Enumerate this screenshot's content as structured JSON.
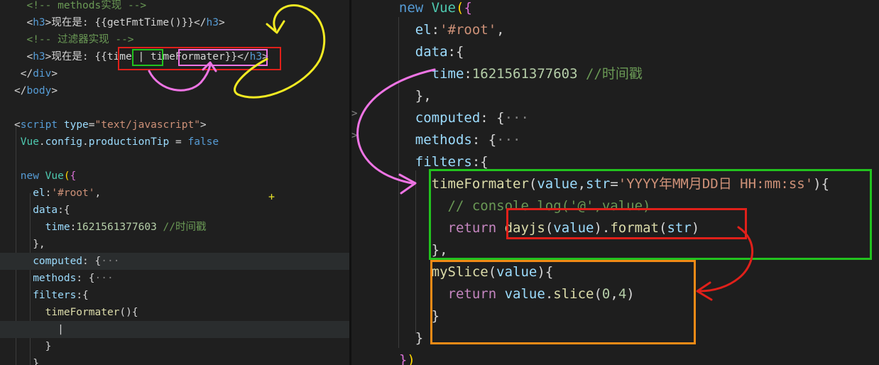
{
  "left_editor": {
    "lines": [
      [
        {
          "c": "t-cm",
          "t": "  <!-- methods实现 -->"
        }
      ],
      [
        {
          "c": "t-tx",
          "t": "  <"
        },
        {
          "c": "t-tag",
          "t": "h3"
        },
        {
          "c": "t-tx",
          "t": ">现在是: {{getFmtTime()}}</"
        },
        {
          "c": "t-tag",
          "t": "h3"
        },
        {
          "c": "t-tx",
          "t": ">"
        }
      ],
      [
        {
          "c": "t-cm",
          "t": "  <!-- 过滤器实现 -->"
        }
      ],
      [
        {
          "c": "t-tx",
          "t": "  <"
        },
        {
          "c": "t-tag",
          "t": "h3"
        },
        {
          "c": "t-tx",
          "t": ">现在是: {{time | timeFormater}}</"
        },
        {
          "c": "t-tag",
          "t": "h3"
        },
        {
          "c": "t-tx",
          "t": ">"
        }
      ],
      [
        {
          "c": "t-tx",
          "t": " </"
        },
        {
          "c": "t-tag",
          "t": "div"
        },
        {
          "c": "t-tx",
          "t": ">"
        }
      ],
      [
        {
          "c": "t-tx",
          "t": "</"
        },
        {
          "c": "t-tag",
          "t": "body"
        },
        {
          "c": "t-tx",
          "t": ">"
        }
      ],
      [],
      [
        {
          "c": "t-tx",
          "t": "<"
        },
        {
          "c": "t-tag",
          "t": "script"
        },
        {
          "c": "t-tx",
          "t": " "
        },
        {
          "c": "t-key",
          "t": "type"
        },
        {
          "c": "t-tx",
          "t": "="
        },
        {
          "c": "t-str",
          "t": "\"text/javascript\""
        },
        {
          "c": "t-tx",
          "t": ">"
        }
      ],
      [
        {
          "c": "t-ty",
          "t": " Vue"
        },
        {
          "c": "t-tx",
          "t": "."
        },
        {
          "c": "t-key",
          "t": "config"
        },
        {
          "c": "t-tx",
          "t": "."
        },
        {
          "c": "t-key",
          "t": "productionTip"
        },
        {
          "c": "t-tx",
          "t": " = "
        },
        {
          "c": "t-bool",
          "t": "false"
        }
      ],
      [],
      [
        {
          "c": "t-bool",
          "t": " new"
        },
        {
          "c": "t-tx",
          "t": " "
        },
        {
          "c": "t-ty",
          "t": "Vue"
        },
        {
          "c": "t-br",
          "t": "("
        },
        {
          "c": "t-pu",
          "t": "{"
        }
      ],
      [
        {
          "c": "t-key",
          "t": "   el"
        },
        {
          "c": "t-tx",
          "t": ":"
        },
        {
          "c": "t-str",
          "t": "'#root'"
        },
        {
          "c": "t-tx",
          "t": ","
        }
      ],
      [
        {
          "c": "t-key",
          "t": "   data"
        },
        {
          "c": "t-tx",
          "t": ":{"
        }
      ],
      [
        {
          "c": "t-key",
          "t": "     time"
        },
        {
          "c": "t-tx",
          "t": ":"
        },
        {
          "c": "t-num",
          "t": "1621561377603"
        },
        {
          "c": "t-tx",
          "t": " "
        },
        {
          "c": "t-cm",
          "t": "//时间戳"
        }
      ],
      [
        {
          "c": "t-tx",
          "t": "   },"
        }
      ],
      [
        {
          "c": "t-key",
          "t": "   computed"
        },
        {
          "c": "t-tx",
          "t": ": {"
        },
        {
          "c": "t-dim",
          "t": "···"
        }
      ],
      [
        {
          "c": "t-key",
          "t": "   methods"
        },
        {
          "c": "t-tx",
          "t": ": {"
        },
        {
          "c": "t-dim",
          "t": "···"
        }
      ],
      [
        {
          "c": "t-key",
          "t": "   filters"
        },
        {
          "c": "t-tx",
          "t": ":{"
        }
      ],
      [
        {
          "c": "t-fn",
          "t": "     timeFormater"
        },
        {
          "c": "t-tx",
          "t": "(){"
        }
      ],
      [
        {
          "c": "t-tx",
          "t": "       |"
        }
      ],
      [
        {
          "c": "t-tx",
          "t": "     }"
        }
      ],
      [
        {
          "c": "t-tx",
          "t": "   }"
        }
      ]
    ]
  },
  "right_editor": {
    "lines": [
      [
        {
          "c": "t-bool",
          "t": "  new"
        },
        {
          "c": "t-tx",
          "t": " "
        },
        {
          "c": "t-ty",
          "t": "Vue"
        },
        {
          "c": "t-br",
          "t": "("
        },
        {
          "c": "t-pu",
          "t": "{"
        }
      ],
      [
        {
          "c": "t-key",
          "t": "    el"
        },
        {
          "c": "t-tx",
          "t": ":"
        },
        {
          "c": "t-str",
          "t": "'#root'"
        },
        {
          "c": "t-tx",
          "t": ","
        }
      ],
      [
        {
          "c": "t-key",
          "t": "    data"
        },
        {
          "c": "t-tx",
          "t": ":{"
        }
      ],
      [
        {
          "c": "t-key",
          "t": "      time"
        },
        {
          "c": "t-tx",
          "t": ":"
        },
        {
          "c": "t-num",
          "t": "1621561377603"
        },
        {
          "c": "t-tx",
          "t": " "
        },
        {
          "c": "t-cm",
          "t": "//时间戳"
        }
      ],
      [
        {
          "c": "t-tx",
          "t": "    },"
        }
      ],
      [
        {
          "c": "t-key",
          "t": "    computed"
        },
        {
          "c": "t-tx",
          "t": ": {"
        },
        {
          "c": "t-dim",
          "t": "···"
        }
      ],
      [
        {
          "c": "t-key",
          "t": "    methods"
        },
        {
          "c": "t-tx",
          "t": ": {"
        },
        {
          "c": "t-dim",
          "t": "···"
        }
      ],
      [
        {
          "c": "t-key",
          "t": "    filters"
        },
        {
          "c": "t-tx",
          "t": ":{"
        }
      ],
      [
        {
          "c": "t-fn",
          "t": "      timeFormater"
        },
        {
          "c": "t-tx",
          "t": "("
        },
        {
          "c": "t-key",
          "t": "value"
        },
        {
          "c": "t-tx",
          "t": ","
        },
        {
          "c": "t-key",
          "t": "str"
        },
        {
          "c": "t-tx",
          "t": "="
        },
        {
          "c": "t-str",
          "t": "'YYYY年MM月DD日 HH:mm:ss'"
        },
        {
          "c": "t-tx",
          "t": "){"
        }
      ],
      [
        {
          "c": "t-cm",
          "t": "        // console.log('@',value)"
        }
      ],
      [
        {
          "c": "t-kw",
          "t": "        return"
        },
        {
          "c": "t-tx",
          "t": " "
        },
        {
          "c": "t-fn",
          "t": "dayjs"
        },
        {
          "c": "t-tx",
          "t": "("
        },
        {
          "c": "t-key",
          "t": "value"
        },
        {
          "c": "t-tx",
          "t": ")."
        },
        {
          "c": "t-fn",
          "t": "format"
        },
        {
          "c": "t-tx",
          "t": "("
        },
        {
          "c": "t-key",
          "t": "str"
        },
        {
          "c": "t-tx",
          "t": ")"
        }
      ],
      [
        {
          "c": "t-tx",
          "t": "      },"
        }
      ],
      [
        {
          "c": "t-fn",
          "t": "      mySlice"
        },
        {
          "c": "t-tx",
          "t": "("
        },
        {
          "c": "t-key",
          "t": "value"
        },
        {
          "c": "t-tx",
          "t": "){"
        }
      ],
      [
        {
          "c": "t-kw",
          "t": "        return"
        },
        {
          "c": "t-tx",
          "t": " "
        },
        {
          "c": "t-key",
          "t": "value"
        },
        {
          "c": "t-tx",
          "t": "."
        },
        {
          "c": "t-fn",
          "t": "slice"
        },
        {
          "c": "t-tx",
          "t": "("
        },
        {
          "c": "t-num",
          "t": "0"
        },
        {
          "c": "t-tx",
          "t": ","
        },
        {
          "c": "t-num",
          "t": "4"
        },
        {
          "c": "t-tx",
          "t": ")"
        }
      ],
      [
        {
          "c": "t-tx",
          "t": "      }"
        }
      ],
      [
        {
          "c": "t-tx",
          "t": "    }"
        }
      ],
      [
        {
          "c": "t-pu",
          "t": "  }"
        },
        {
          "c": "t-br",
          "t": ")"
        }
      ]
    ]
  },
  "fold_markers": [
    ">",
    ">"
  ],
  "cursor_marker": "+",
  "annotation_colors": {
    "red": "#e0201a",
    "green": "#22c21e",
    "pink": "#ee74e4",
    "yellow": "#f2ea22",
    "orange": "#f08a16"
  }
}
